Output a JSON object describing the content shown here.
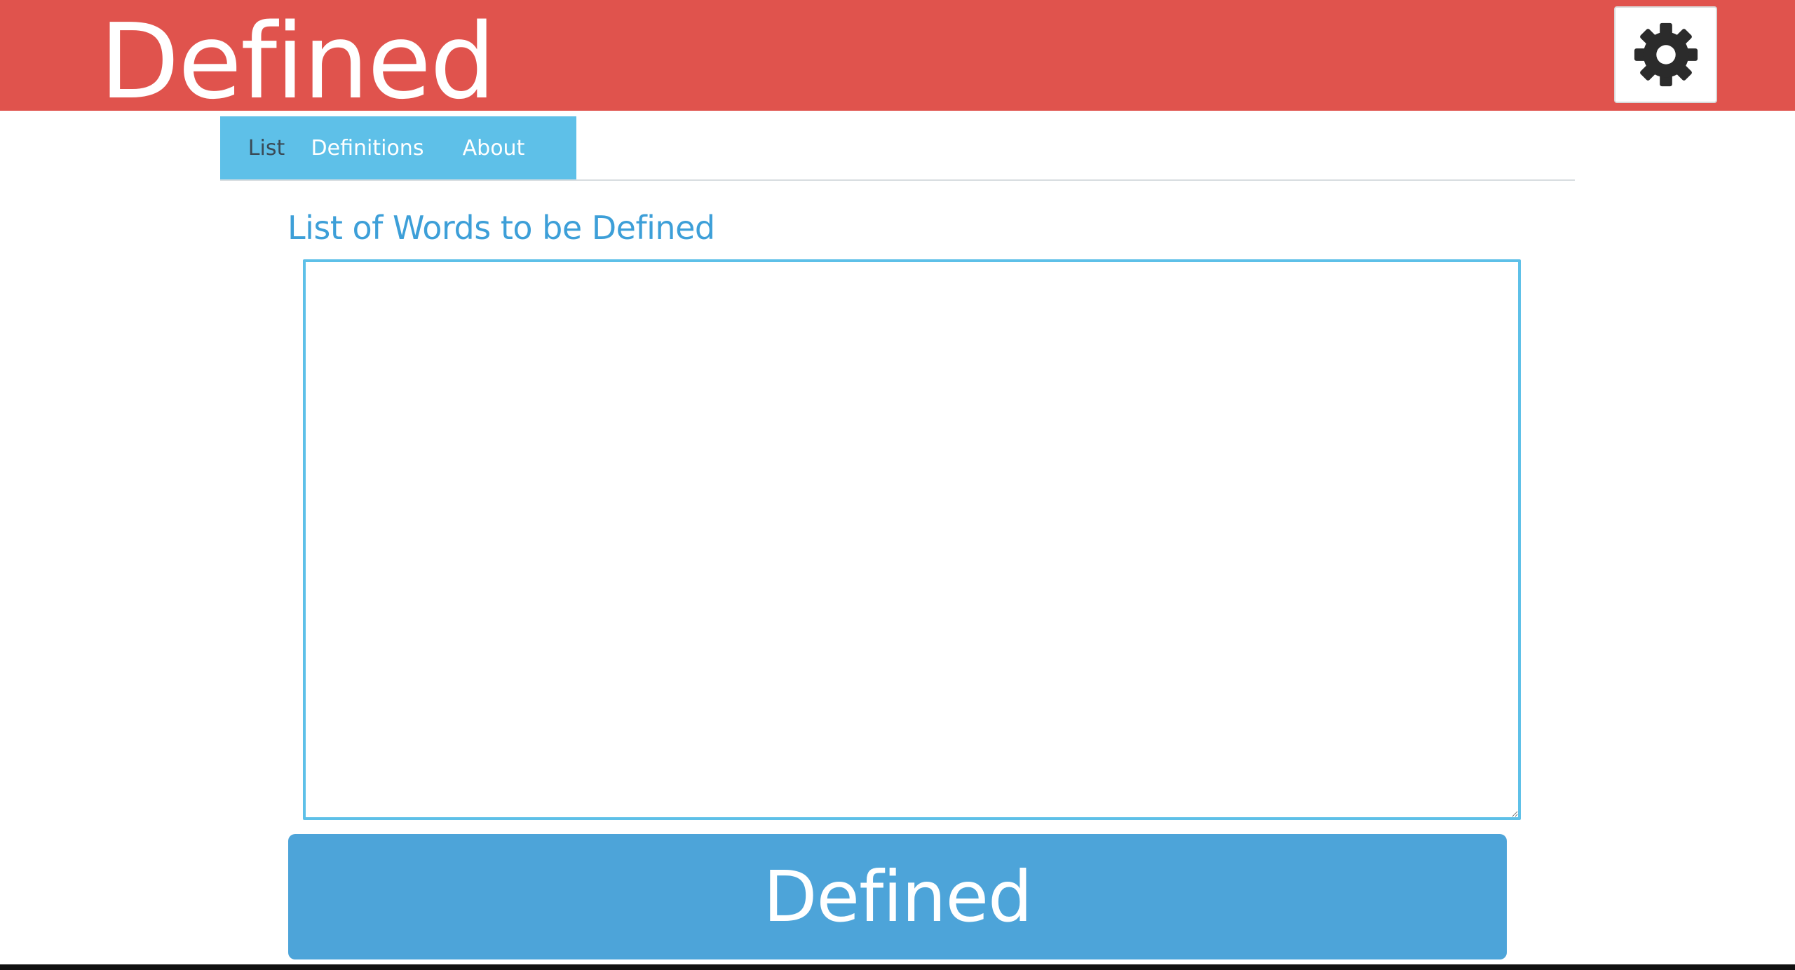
{
  "header": {
    "title": "Defined",
    "settings_icon": "gear-icon",
    "background_color": "#e0534d"
  },
  "tabs": [
    {
      "label": "List",
      "active": true
    },
    {
      "label": "Definitions",
      "active": false
    },
    {
      "label": "About",
      "active": false
    }
  ],
  "main": {
    "heading": "List of Words to be Defined",
    "word_list": {
      "value": "",
      "placeholder": ""
    },
    "submit_label": "Defined"
  },
  "colors": {
    "accent": "#5ec0e8",
    "heading": "#3d9fd8",
    "button": "#4da4d9"
  }
}
